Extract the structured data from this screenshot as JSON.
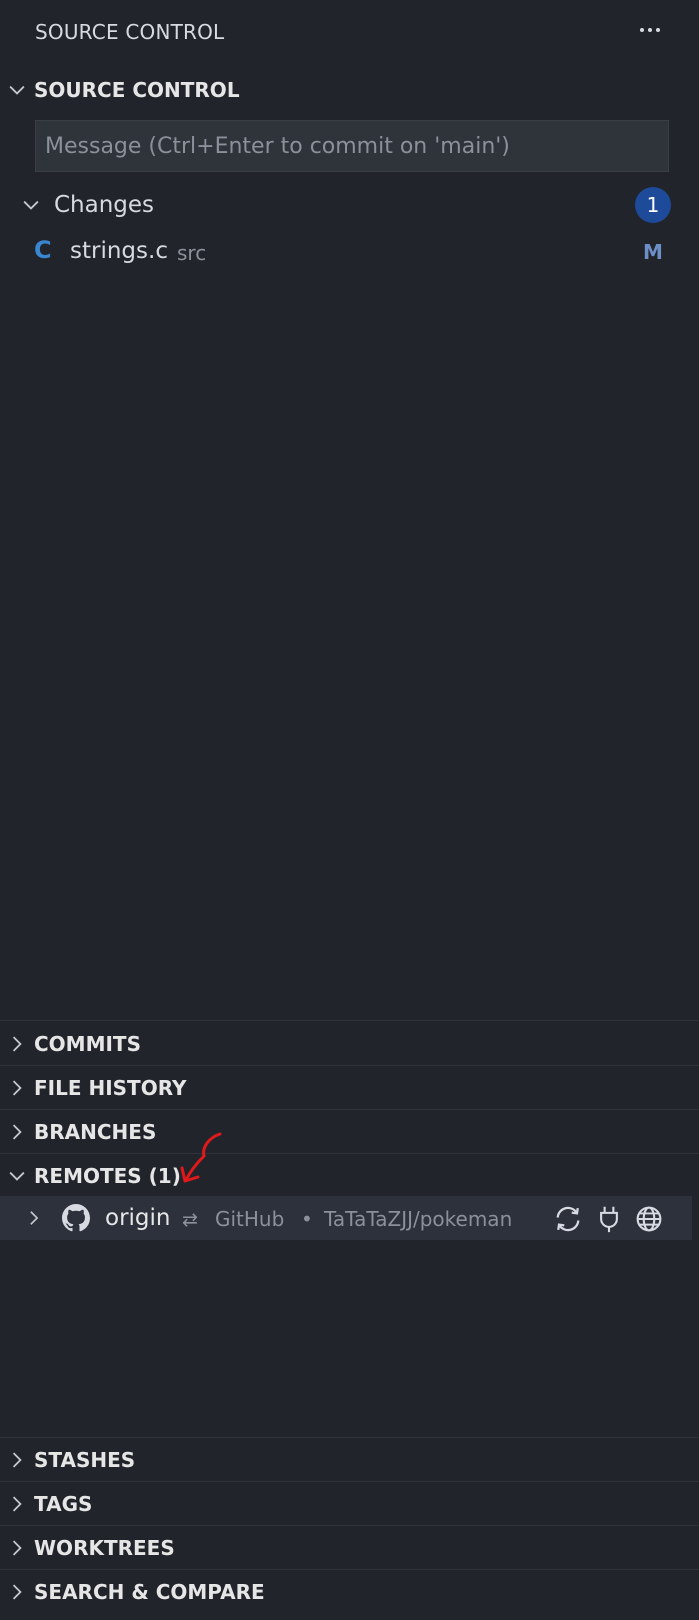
{
  "view": {
    "title": "SOURCE CONTROL"
  },
  "source_control": {
    "header": "SOURCE CONTROL",
    "commit_message": {
      "placeholder": "Message (Ctrl+Enter to commit on 'main')",
      "value": ""
    },
    "changes": {
      "label": "Changes",
      "count": "1",
      "files": [
        {
          "icon": "C",
          "name": "strings.c",
          "path": "src",
          "status": "M"
        }
      ]
    }
  },
  "sections": {
    "commits": "COMMITS",
    "file_history": "FILE HISTORY",
    "branches": "BRANCHES",
    "remotes": "REMOTES (1)",
    "stashes": "STASHES",
    "tags": "TAGS",
    "worktrees": "WORKTREES",
    "search_compare": "SEARCH & COMPARE"
  },
  "remotes": [
    {
      "name": "origin",
      "direction_glyph": "⇄",
      "provider": "GitHub",
      "separator": "•",
      "repo": "TaTaTaZJJ/pokeman",
      "actions": [
        "sync-icon",
        "plug-icon",
        "globe-icon"
      ]
    }
  ],
  "colors": {
    "background": "#21252b",
    "badge": "#1e4a9a",
    "c_file_icon": "#3a86d1",
    "modified": "#6c8fc7",
    "selected_row": "#2c313c",
    "annotation_arrow": "#e0191a"
  }
}
